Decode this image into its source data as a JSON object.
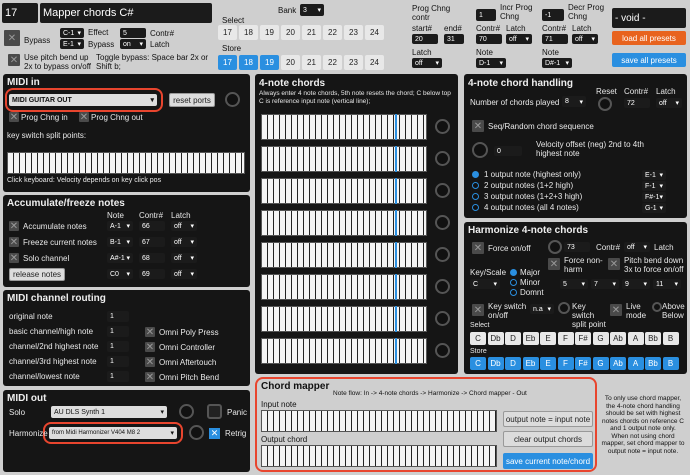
{
  "header": {
    "preset_number": "17",
    "title": "Mapper chords C#",
    "bank_label": "Bank",
    "bank_value": "3",
    "void_label": "- void -",
    "load_all": "load all presets",
    "save_all": "save all presets"
  },
  "select": {
    "label": "Select",
    "numbers": [
      "17",
      "18",
      "19",
      "20",
      "21",
      "22",
      "23",
      "24"
    ]
  },
  "store": {
    "label": "Store",
    "numbers": [
      "17",
      "18",
      "19",
      "20",
      "21",
      "22",
      "23",
      "24"
    ]
  },
  "bypass": {
    "label": "Bypass",
    "effect_note": "C-1",
    "effect_label": "Effect",
    "bypass_note": "E-1",
    "bypass_label": "Bypass",
    "contr_val": "5",
    "contr_label": "Contr#",
    "latch_val": "on",
    "latch_label": "Latch",
    "pitch_text": "Use pitch bend up 2x to bypass on/off",
    "toggle_text": "Toggle bypass: Space bar 2x or Shift b;"
  },
  "prog_chng": {
    "label": "Prog Chng contr",
    "start_label": "start#",
    "start_val": "20",
    "end_label": "end#",
    "end_val": "31",
    "latch_label": "Latch",
    "latch_val": "off",
    "incr_label": "Incr Prog Chng",
    "incr_val": "1",
    "incr_contr_val": "70",
    "incr_contr_label": "Contr#",
    "incr_latch_val": "off",
    "incr_latch_label": "Latch",
    "incr_note_label": "Note",
    "incr_note": "D-1",
    "decr_label": "Decr Prog Chng",
    "decr_val": "-1",
    "decr_contr_val": "71",
    "decr_contr_label": "Contr#",
    "decr_latch_val": "off",
    "decr_latch_label": "Latch",
    "decr_note_label": "Note",
    "decr_note": "D#-1"
  },
  "midi_in": {
    "title": "MIDI in",
    "device": "MIDI GUITAR OUT",
    "reset": "reset ports",
    "prog_in": "Prog Chng in",
    "prog_out": "Prog Chng out",
    "split_label": "key switch split points:",
    "click_hint": "Click keyboard: Velocity depends on key click pos"
  },
  "accumulate": {
    "title": "Accumulate/freeze notes",
    "col_note": "Note",
    "col_contr": "Contr#",
    "col_latch": "Latch",
    "rows": [
      {
        "label": "Accumulate notes",
        "note": "A-1",
        "contr": "66",
        "latch": "off"
      },
      {
        "label": "Freeze current notes",
        "note": "B-1",
        "contr": "67",
        "latch": "off"
      },
      {
        "label": "Solo channel",
        "note": "A#-1",
        "contr": "68",
        "latch": "off"
      },
      {
        "label": "release notes",
        "note": "C0",
        "contr": "69",
        "latch": "off"
      }
    ]
  },
  "routing": {
    "title": "MIDI channel routing",
    "rows": [
      {
        "label": "original note",
        "val": "1"
      },
      {
        "label": "basic channel/high note",
        "val": "1"
      },
      {
        "label": "channel/2nd highest note",
        "val": "1"
      },
      {
        "label": "channel/3rd highest note",
        "val": "1"
      },
      {
        "label": "channel/lowest note",
        "val": "1"
      }
    ],
    "omni": [
      "Omni Poly Press",
      "Omni Controller",
      "Omni Aftertouch",
      "Omni Pitch Bend"
    ]
  },
  "midi_out": {
    "title": "MIDI out",
    "solo_label": "Solo",
    "solo_device": "AU DLS Synth 1",
    "harm_label": "Harmonize",
    "harm_device": "from Midi Harmonizer V404 M8 2",
    "panic": "Panic",
    "retrig": "Retrig"
  },
  "four_note": {
    "title": "4-note chords",
    "desc": "Always enter 4 note chords, 5th note resets the chord; C below top C is reference input note (vertical line);"
  },
  "handling": {
    "title": "4-note chord handling",
    "num_label": "Number of chords played",
    "num_val": "8",
    "reset": "Reset",
    "contr_label": "Contr#",
    "contr_val": "72",
    "latch_label": "Latch",
    "latch_val": "off",
    "seq": "Seq/Random chord sequence",
    "vel_label": "Velocity offset (neg) 2nd to 4th highest note",
    "vel_val": "0",
    "options": [
      {
        "label": "1 output note (highest only)",
        "note": "E-1"
      },
      {
        "label": "2 output notes (1+2 high)",
        "note": "F-1"
      },
      {
        "label": "3 output notes (1+2+3 high)",
        "note": "F#-1"
      },
      {
        "label": "4 output notes (all 4 notes)",
        "note": "G-1"
      }
    ]
  },
  "harmonize": {
    "title": "Harmonize 4-note chords",
    "force_label": "Force on/off",
    "force_val": "73",
    "contr_label": "Contr#",
    "latch_val": "off",
    "latch_label": "Latch",
    "force_nh": "Force non-harm",
    "pitch_down": "Pitch bend down 3x to force on/off",
    "key_label": "Key/Scale",
    "key_val": "C",
    "scales": [
      "Major",
      "Minor",
      "Domnt"
    ],
    "scale_vals": [
      "5",
      "7",
      "9",
      "11"
    ],
    "ks_label": "Key switch on/off",
    "ks_val": "n.a",
    "ksplit_label": "Key switch split point",
    "live_label": "Live mode",
    "above_label": "Above Below",
    "select_label": "Select",
    "store_label": "Store",
    "notes": [
      "C",
      "Db",
      "D",
      "Eb",
      "E",
      "F",
      "F#",
      "G",
      "Ab",
      "A",
      "Bb",
      "B"
    ]
  },
  "mapper": {
    "title": "Chord mapper",
    "flow": "Note flow: In -> 4-note chords -> Harmonize -> Chord mapper - Out",
    "input_label": "Input note",
    "output_label": "Output chord",
    "btn1": "output note = input note",
    "btn2": "clear output chords",
    "btn3": "save current note/chord",
    "info": "To only use chord mapper, the 4-note chord handling should be set with highest notes chords on reference C and 1 output note only. When not using chord mapper, set chord mapper to output note = input note."
  }
}
